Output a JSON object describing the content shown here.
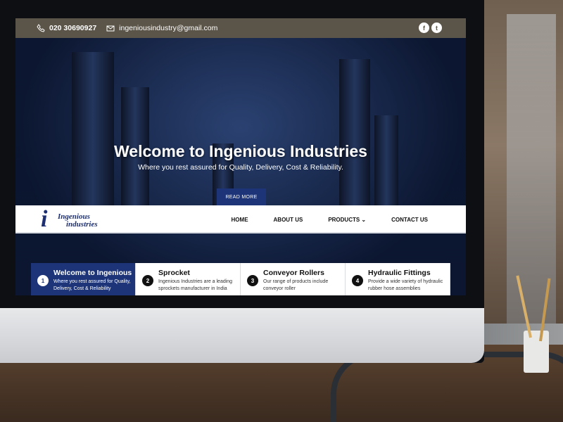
{
  "topbar": {
    "phone": "020 30690927",
    "email": "ingeniousindustry@gmail.com",
    "social": [
      "f",
      "t"
    ],
    "icons": [
      "phone-icon",
      "mail-icon",
      "facebook-icon",
      "twitter-icon"
    ]
  },
  "hero": {
    "title": "Welcome to Ingenious Industries",
    "subtitle": "Where you rest assured for Quality, Delivery, Cost & Reliability.",
    "button": "READ MORE"
  },
  "logo": {
    "mark": "i",
    "line1": "Ingenious",
    "line2": "industries"
  },
  "nav": {
    "items": [
      "HOME",
      "ABOUT US",
      "PRODUCTS ⌄",
      "CONTACT US"
    ]
  },
  "cards": [
    {
      "num": "1",
      "title": "Welcome to Ingenious",
      "desc": "Where you rest assured for Quality, Delivery, Cost & Reliability"
    },
    {
      "num": "2",
      "title": "Sprocket",
      "desc": "Ingenious Industries are a leading sprockets manufacturer in India"
    },
    {
      "num": "3",
      "title": "Conveyor Rollers",
      "desc": "Our range of products include conveyor roller"
    },
    {
      "num": "4",
      "title": "Hydraulic Fittings",
      "desc": "Provide a wide variety of hydraulic rubber hose assemblies"
    }
  ],
  "colors": {
    "topbar": "#5b5448",
    "accent": "#1d3578",
    "logo": "#1d2f70"
  }
}
